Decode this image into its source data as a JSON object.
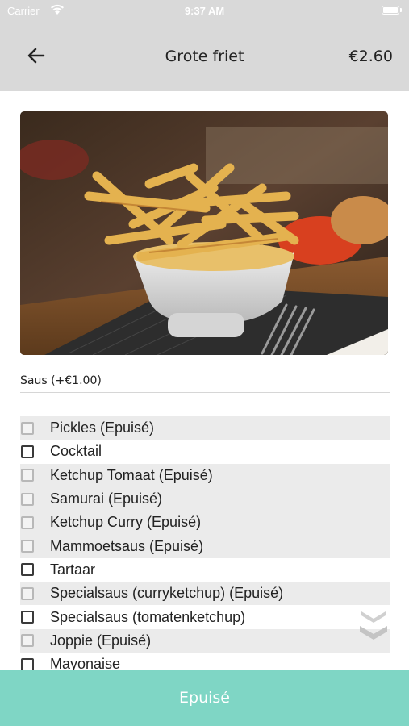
{
  "status_bar": {
    "carrier": "Carrier",
    "time": "9:37 AM",
    "wifi_icon": "wifi-icon",
    "battery_icon": "battery-icon"
  },
  "header": {
    "title": "Grote friet",
    "price": "€2.60",
    "back_icon": "arrow-left-icon"
  },
  "product": {
    "image": "photo of fries in a white bowl"
  },
  "section": {
    "label": "Saus (+€1.00)"
  },
  "options": [
    {
      "label": "Pickles (Epuisé)",
      "available": false,
      "checked": false
    },
    {
      "label": "Cocktail",
      "available": true,
      "checked": false
    },
    {
      "label": "Ketchup Tomaat (Epuisé)",
      "available": false,
      "checked": false
    },
    {
      "label": "Samurai (Epuisé)",
      "available": false,
      "checked": false
    },
    {
      "label": "Ketchup Curry (Epuisé)",
      "available": false,
      "checked": false
    },
    {
      "label": "Mammoetsaus (Epuisé)",
      "available": false,
      "checked": false
    },
    {
      "label": "Tartaar",
      "available": true,
      "checked": false
    },
    {
      "label": "Specialsaus (curryketchup) (Epuisé)",
      "available": false,
      "checked": false
    },
    {
      "label": "Specialsaus (tomatenketchup)",
      "available": true,
      "checked": false
    },
    {
      "label": "Joppie (Epuisé)",
      "available": false,
      "checked": false
    },
    {
      "label": "Mayonaise",
      "available": true,
      "checked": false
    }
  ],
  "scroll_hint_icon": "double-chevron-down-icon",
  "footer": {
    "button_label": "Epuisé"
  },
  "colors": {
    "bar": "#d9d9d9",
    "accent": "#7fd6c5",
    "disabled_row": "#ebebeb"
  }
}
